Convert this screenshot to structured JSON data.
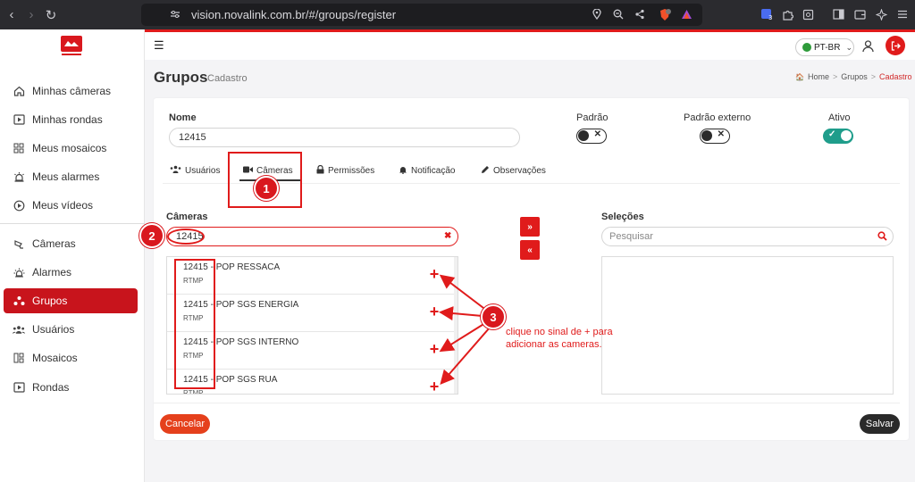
{
  "browser": {
    "url": "vision.novalink.com.br/#/groups/register"
  },
  "sidebar": {
    "items": [
      {
        "label": "Minhas câmeras",
        "icon": "home-icon"
      },
      {
        "label": "Minhas rondas",
        "icon": "play-square-icon"
      },
      {
        "label": "Meus mosaicos",
        "icon": "grid-icon"
      },
      {
        "label": "Meus alarmes",
        "icon": "alarm-light-icon"
      },
      {
        "label": "Meus vídeos",
        "icon": "play-circle-icon"
      },
      {
        "label": "Câmeras",
        "icon": "camera-icon"
      },
      {
        "label": "Alarmes",
        "icon": "siren-icon"
      },
      {
        "label": "Grupos",
        "icon": "group-icon"
      },
      {
        "label": "Usuários",
        "icon": "users-icon"
      },
      {
        "label": "Mosaicos",
        "icon": "mosaic-icon"
      },
      {
        "label": "Rondas",
        "icon": "rounds-icon"
      }
    ],
    "active": "Grupos"
  },
  "header": {
    "language": "PT-BR"
  },
  "page": {
    "title": "Grupos",
    "subtitle": "Cadastro",
    "breadcrumb": [
      "Home",
      "Grupos",
      "Cadastro"
    ]
  },
  "form": {
    "name_label": "Nome",
    "name_value": "12415",
    "toggles": [
      {
        "label": "Padrão",
        "on": false
      },
      {
        "label": "Padrão externo",
        "on": false
      },
      {
        "label": "Ativo",
        "on": true
      }
    ]
  },
  "tabs": [
    {
      "label": "Usuários",
      "icon": "users-icon"
    },
    {
      "label": "Câmeras",
      "icon": "video-camera-icon"
    },
    {
      "label": "Permissões",
      "icon": "lock-icon"
    },
    {
      "label": "Notificação",
      "icon": "bell-icon"
    },
    {
      "label": "Observações",
      "icon": "pencil-icon"
    }
  ],
  "active_tab": "Câmeras",
  "cameras": {
    "label": "Câmeras",
    "search_value": "12415",
    "items": [
      {
        "name": "12415 - POP RESSACA",
        "type": "RTMP"
      },
      {
        "name": "12415 - POP SGS ENERGIA",
        "type": "RTMP"
      },
      {
        "name": "12415 - POP SGS INTERNO",
        "type": "RTMP"
      },
      {
        "name": "12415 - POP SGS RUA",
        "type": "RTMP"
      }
    ]
  },
  "selections": {
    "label": "Seleções",
    "search_placeholder": "Pesquisar"
  },
  "transfer": {
    "add_all": "»",
    "remove_all": "«"
  },
  "buttons": {
    "cancel": "Cancelar",
    "save": "Salvar"
  },
  "annotations": {
    "steps": [
      "1",
      "2",
      "3"
    ],
    "note": "clique no sinal de + para adicionar as cameras.",
    "color": "#e01b1b"
  }
}
